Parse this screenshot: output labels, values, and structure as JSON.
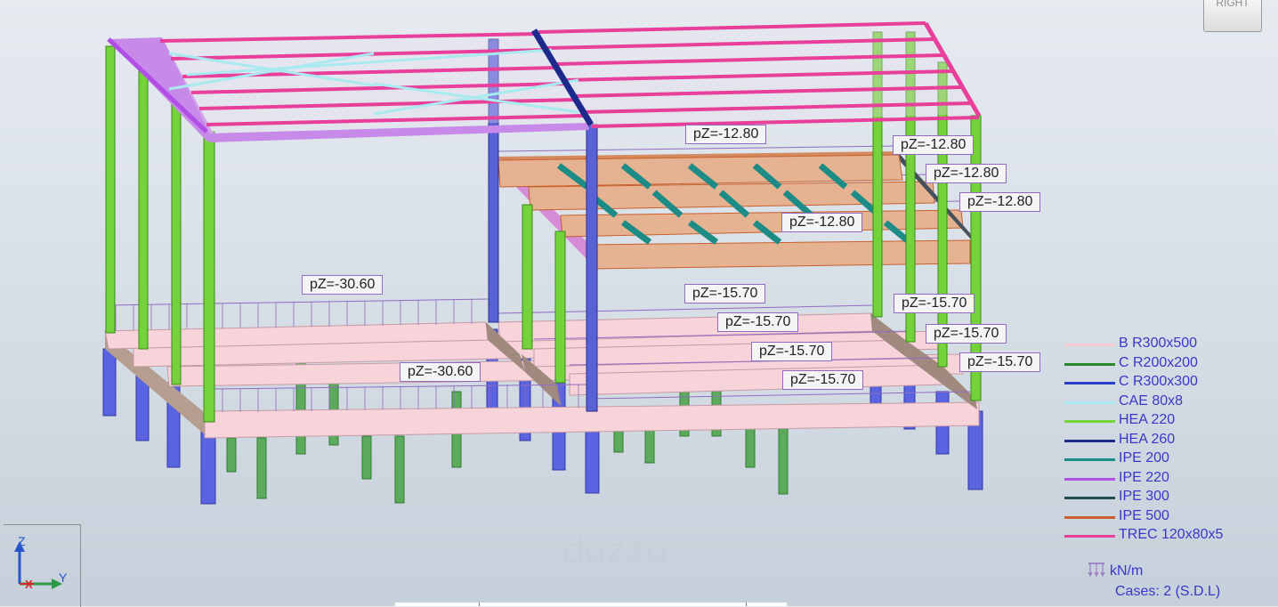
{
  "view_cube": {
    "label": "RIGHT"
  },
  "load_labels": [
    "pZ=-12.80",
    "pZ=-12.80",
    "pZ=-12.80",
    "pZ=-12.80",
    "pZ=-12.80",
    "pZ=-30.60",
    "pZ=-30.60",
    "pZ=-15.70",
    "pZ=-15.70",
    "pZ=-15.70",
    "pZ=-15.70",
    "pZ=-15.70",
    "pZ=-15.70",
    "pZ=-15.70"
  ],
  "legend": {
    "items": [
      {
        "label": "B R300x500",
        "color": "#f5c9d2"
      },
      {
        "label": "C R200x200",
        "color": "#2a8a2a"
      },
      {
        "label": "C R300x300",
        "color": "#2b3ec9"
      },
      {
        "label": "CAE 80x8",
        "color": "#a8eaf0"
      },
      {
        "label": "HEA 220",
        "color": "#74d23a"
      },
      {
        "label": "HEA 260",
        "color": "#1d2a8c"
      },
      {
        "label": "IPE 200",
        "color": "#1d8c86"
      },
      {
        "label": "IPE 220",
        "color": "#b04ee6"
      },
      {
        "label": "IPE 300",
        "color": "#244b4f"
      },
      {
        "label": "IPE 500",
        "color": "#c8602c"
      },
      {
        "label": "TREC 120x80x5",
        "color": "#e8409a"
      }
    ]
  },
  "units": {
    "label": "kN/m"
  },
  "cases": {
    "label": "Cases: 2 (S.D.L)"
  },
  "axes": {
    "z": "Z",
    "y": "Y",
    "x": "X"
  },
  "watermark": "dozzo"
}
